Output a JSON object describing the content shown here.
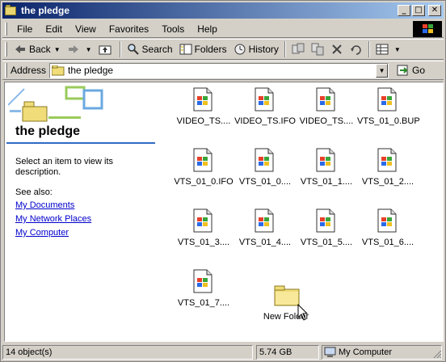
{
  "window": {
    "title": "the pledge"
  },
  "titlebar": {
    "minimize": "_",
    "maximize": "□",
    "close": "✕"
  },
  "menubar": {
    "items": [
      "File",
      "Edit",
      "View",
      "Favorites",
      "Tools",
      "Help"
    ]
  },
  "toolbar": {
    "back": "Back",
    "search": "Search",
    "folders": "Folders",
    "history": "History",
    "icons": [
      "back-arrow-icon",
      "forward-arrow-icon",
      "up-folder-icon",
      "search-icon",
      "folders-icon",
      "history-icon",
      "move-to-icon",
      "copy-to-icon",
      "delete-icon",
      "undo-icon",
      "views-icon"
    ]
  },
  "addressbar": {
    "label": "Address",
    "value": "the pledge",
    "go": "Go"
  },
  "leftpane": {
    "title": "the pledge",
    "description": "Select an item to view its description.",
    "see_also": "See also:",
    "links": [
      "My Documents",
      "My Network Places",
      "My Computer"
    ]
  },
  "files": [
    {
      "name": "VIDEO_TS...."
    },
    {
      "name": "VIDEO_TS.IFO"
    },
    {
      "name": "VIDEO_TS...."
    },
    {
      "name": "VTS_01_0.BUP"
    },
    {
      "name": "VTS_01_0.IFO"
    },
    {
      "name": "VTS_01_0...."
    },
    {
      "name": "VTS_01_1...."
    },
    {
      "name": "VTS_01_2...."
    },
    {
      "name": "VTS_01_3...."
    },
    {
      "name": "VTS_01_4...."
    },
    {
      "name": "VTS_01_5...."
    },
    {
      "name": "VTS_01_6...."
    },
    {
      "name": "VTS_01_7...."
    }
  ],
  "new_folder": {
    "name": "New Folder"
  },
  "statusbar": {
    "objects": "14 object(s)",
    "size": "5.74 GB",
    "location": "My Computer"
  },
  "colors": {
    "title_start": "#0a246a",
    "title_end": "#a6caf0",
    "link": "#0000cc",
    "accent_rule": "#316ac5"
  }
}
